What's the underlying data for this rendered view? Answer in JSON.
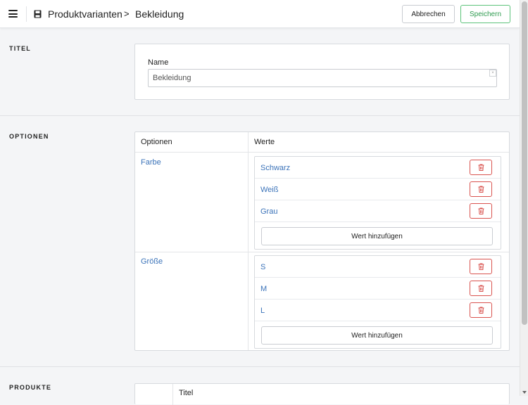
{
  "header": {
    "breadcrumb_root": "Produktvarianten",
    "breadcrumb_separator": ">",
    "breadcrumb_current": "Bekleidung",
    "cancel_label": "Abbrechen",
    "save_label": "Speichern"
  },
  "title_section": {
    "label": "TITEL",
    "name_label": "Name",
    "name_value": "Bekleidung"
  },
  "options_section": {
    "label": "OPTIONEN",
    "col_options": "Optionen",
    "col_values": "Werte",
    "add_value_label": "Wert hinzufügen",
    "options": [
      {
        "name": "Farbe",
        "values": [
          "Schwarz",
          "Weiß",
          "Grau"
        ]
      },
      {
        "name": "Größe",
        "values": [
          "S",
          "M",
          "L"
        ]
      }
    ]
  },
  "products_section": {
    "label": "PRODUKTE",
    "col_title": "Titel"
  },
  "icons": {
    "menu": "menu-icon",
    "save": "save-icon",
    "delete": "trash-icon"
  },
  "colors": {
    "accent_link": "#3b73b9",
    "save_green": "#2e9b4f",
    "delete_red": "#d9534f"
  }
}
